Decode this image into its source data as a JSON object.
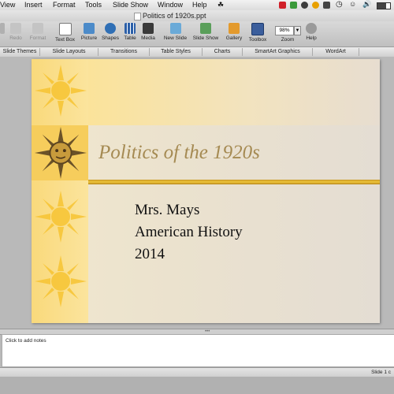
{
  "menu": {
    "items": [
      "View",
      "Insert",
      "Format",
      "Tools",
      "Slide Show",
      "Window",
      "Help"
    ]
  },
  "window": {
    "title": "Politics of 1920s.ppt"
  },
  "toolbar": {
    "buttons": [
      "Text Box",
      "Picture",
      "Shapes",
      "Table",
      "Media",
      "New Slide",
      "Slide Show",
      "Gallery",
      "Toolbox",
      "Zoom",
      "Help"
    ],
    "dim_labels": [
      "Redo",
      "Format"
    ],
    "zoom_value": "98%"
  },
  "ribbon": {
    "tabs": [
      "Slide Themes",
      "Slide Layouts",
      "Transitions",
      "Table Styles",
      "Charts",
      "SmartArt Graphics",
      "WordArt"
    ]
  },
  "slide": {
    "title": "Politics of the 1920s",
    "lines": [
      "Mrs. Mays",
      "American History",
      "2014"
    ]
  },
  "notes": {
    "placeholder": "Click to add notes"
  },
  "status": {
    "slide_indicator": "Slide 1 c"
  },
  "colors": {
    "title_text": "#a58a52",
    "band": "#f9d97b",
    "rule": "#d8a52a",
    "sun": "#f7c432"
  }
}
